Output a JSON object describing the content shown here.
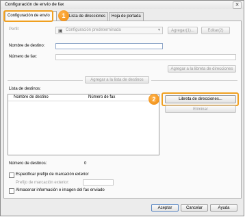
{
  "window": {
    "title": "Configuración de envío de fax",
    "close_glyph": "✕"
  },
  "tabs": [
    {
      "label": "Configuración de envío",
      "active": true
    },
    {
      "label": "Lista de direcciones",
      "active": false
    },
    {
      "label": "Hoja de portada",
      "active": false
    }
  ],
  "profile": {
    "label": "Perfil:",
    "value": "Configuración predeterminada",
    "add_button": "Agregar(1)...",
    "edit_button": "Editar(2)"
  },
  "fields": {
    "destination_name_label": "Nombre de destino:",
    "destination_name_value": "",
    "fax_number_label": "Número de fax:",
    "fax_number_value": ""
  },
  "buttons": {
    "add_to_address_book": "Agregar a la libreta de direcciones",
    "add_to_destination_list": "Agregar a la lista de destinos",
    "address_book": "Libreta de direcciones...",
    "delete": "Eliminar",
    "ok": "Aceptar",
    "cancel": "Cancelar",
    "help": "Ayuda"
  },
  "destination_list": {
    "label": "Lista de destinos:",
    "columns": [
      "Nombre de destino",
      "Número de fax"
    ],
    "rows": []
  },
  "count": {
    "label": "Número de destinos:",
    "value": "0"
  },
  "options": {
    "prefix_checkbox": "Especificar prefijo de marcación exterior",
    "prefix_label": "Prefijo de marcación exterior:",
    "prefix_value": "",
    "store_checkbox": "Almacenar información e imagen del fax enviado"
  },
  "callouts": [
    "1",
    "2"
  ],
  "colors": {
    "callout": "#ee8a0c",
    "highlight_border": "#f0a020",
    "field_border": "#8fa7c8"
  }
}
